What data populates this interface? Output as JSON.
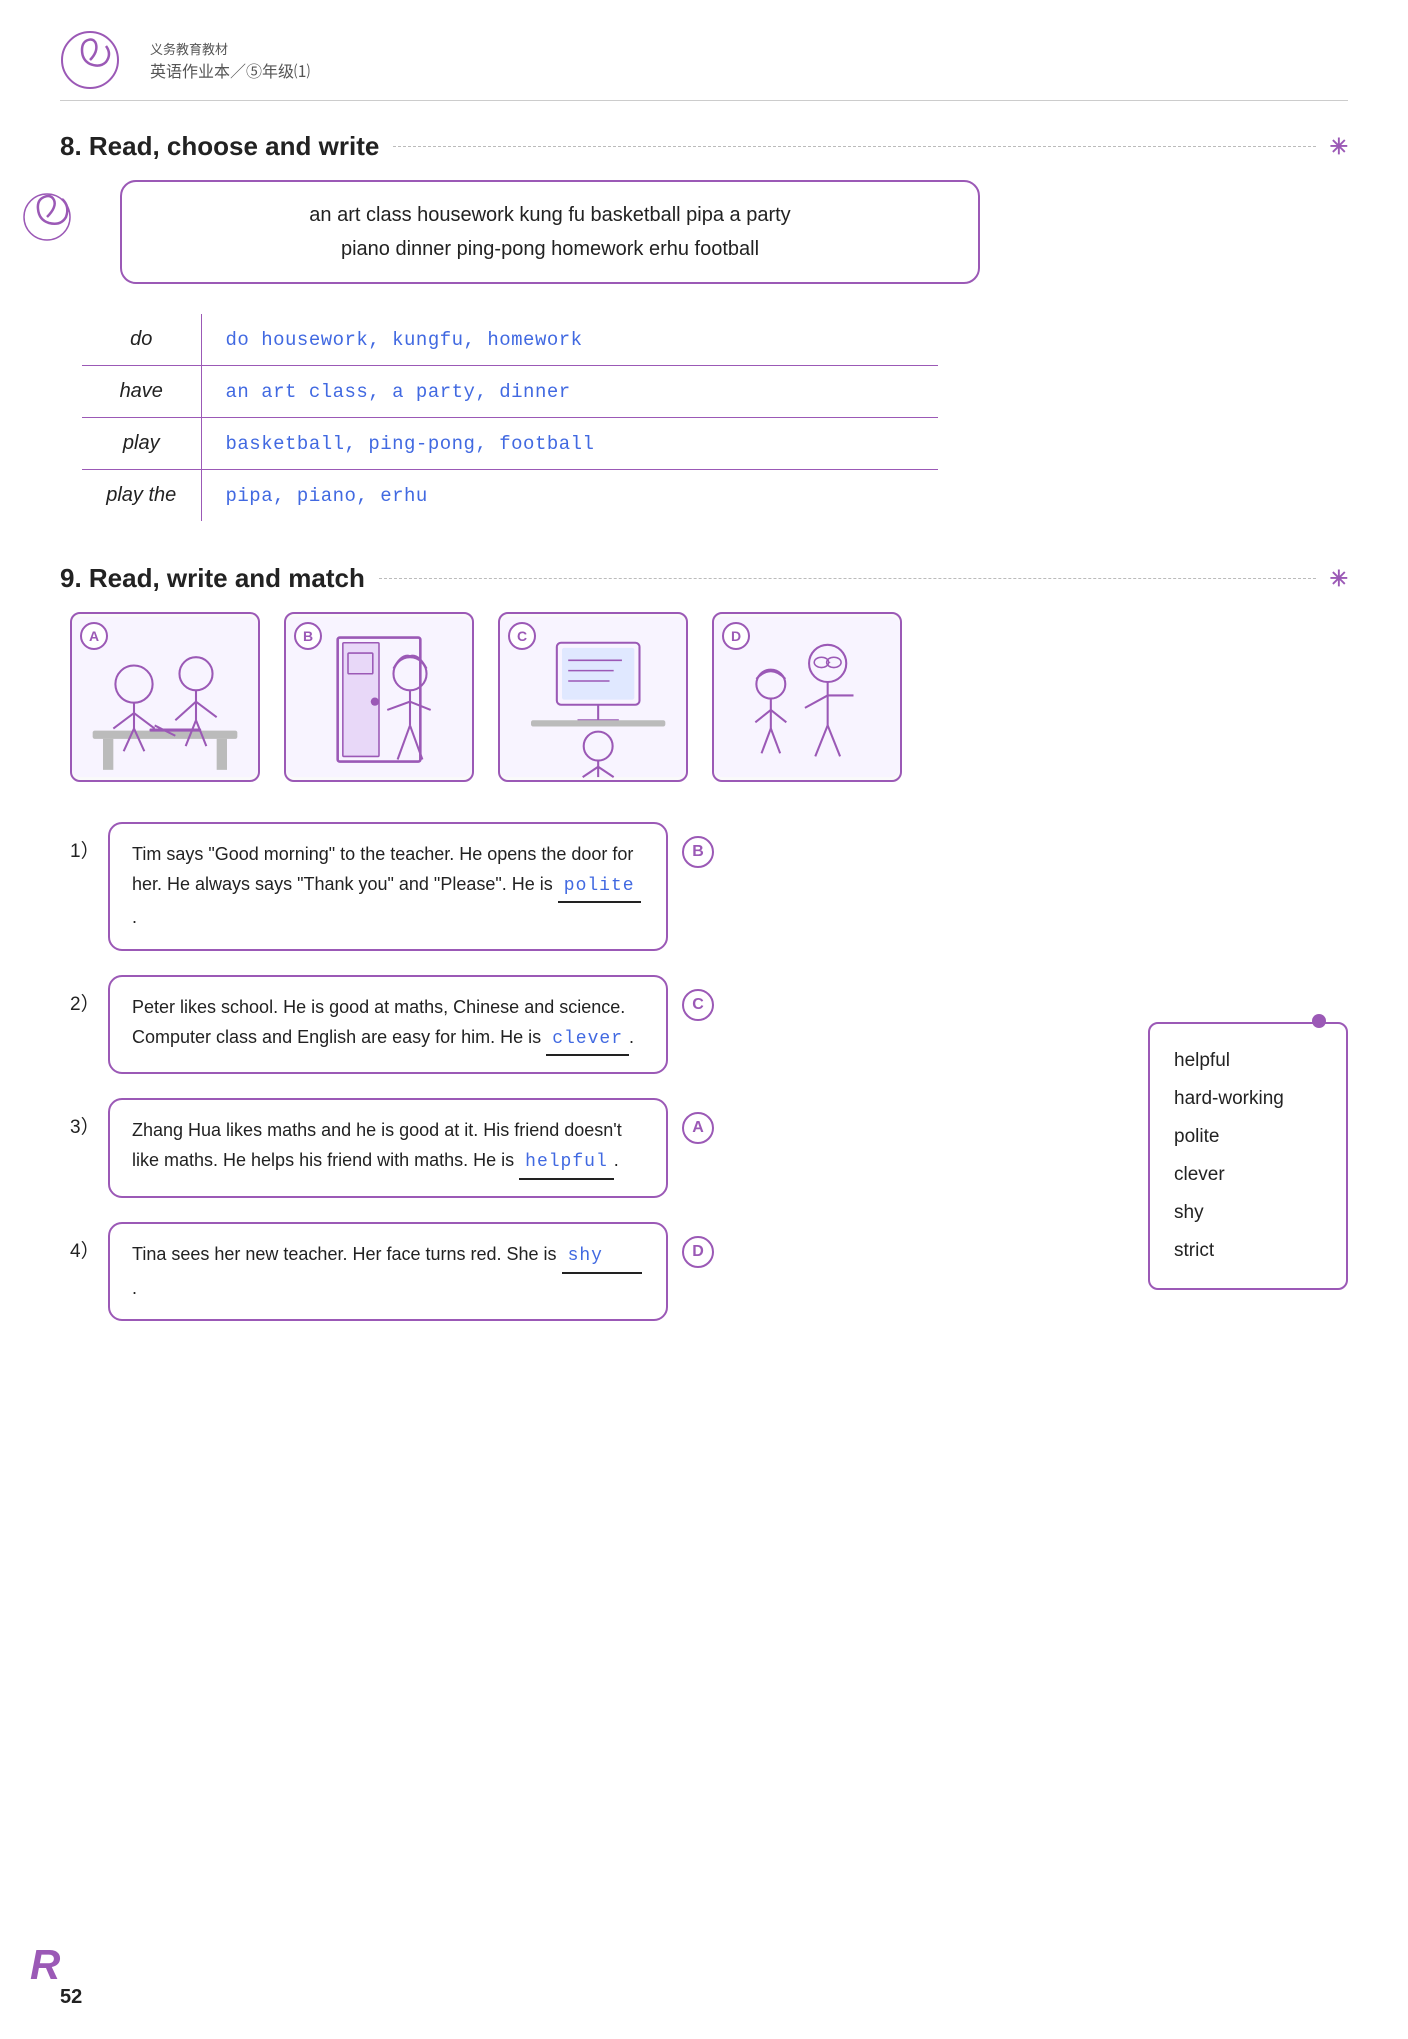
{
  "header": {
    "subtitle": "义务教育教材",
    "title": "英语作业本／⑤年级⑴"
  },
  "section8": {
    "title": "8. Read, choose and write",
    "word_bank": {
      "line1": "an art class   housework   kung fu   basketball   pipa   a party",
      "line2": "piano   dinner   ping-pong   homework   erhu   football"
    },
    "table": {
      "rows": [
        {
          "verb": "do",
          "items": "do housework,  kungfu,  homework"
        },
        {
          "verb": "have",
          "items": "an art class,  a party,  dinner"
        },
        {
          "verb": "play",
          "items": "basketball,  ping-pong,  football"
        },
        {
          "verb": "play the",
          "items": "pipa,  piano,  erhu"
        }
      ]
    }
  },
  "section9": {
    "title": "9. Read, write and match",
    "images": [
      {
        "label": "A",
        "desc": "students writing"
      },
      {
        "label": "B",
        "desc": "girl at door"
      },
      {
        "label": "C",
        "desc": "student at computer"
      },
      {
        "label": "D",
        "desc": "teacher with students"
      }
    ],
    "stories": [
      {
        "number": "1）",
        "text_before": "Tim says \"Good morning\" to the teacher. He opens the door for her. He always says \"Thank you\" and \"Please\". He is",
        "answer": "polite",
        "text_after": ".",
        "match_letter": "B"
      },
      {
        "number": "2）",
        "text_before": "Peter likes school. He is good at maths, Chinese and science. Computer class and English are easy for him. He is",
        "answer": "clever",
        "text_after": ".",
        "match_letter": "C"
      },
      {
        "number": "3）",
        "text_before": "Zhang Hua likes maths and he is good at it. His friend doesn't like maths. He helps his friend with maths. He is",
        "answer": "helpful",
        "text_after": ".",
        "match_letter": "A"
      },
      {
        "number": "4）",
        "text_before": "Tina sees her new teacher. Her face turns red. She is",
        "answer": "shy",
        "text_after": ".",
        "match_letter": "D"
      }
    ],
    "word_list": [
      "helpful",
      "hard-working",
      "polite",
      "clever",
      "shy",
      "strict"
    ]
  },
  "page_number": "52"
}
